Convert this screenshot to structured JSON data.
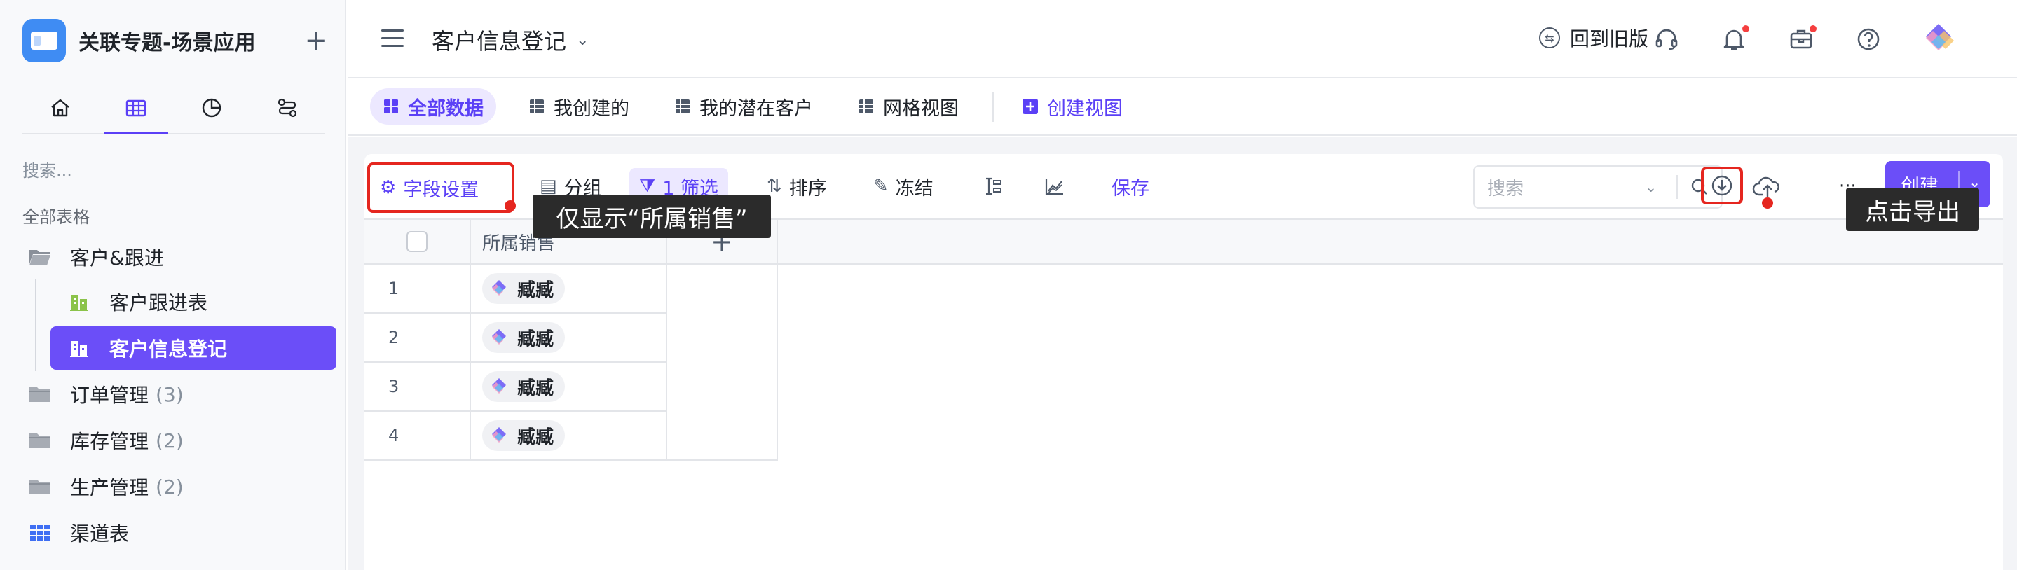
{
  "app": {
    "title": "关联专题-场景应用",
    "plus": "+"
  },
  "sidebar": {
    "search_placeholder": "搜索...",
    "section_title": "全部表格",
    "items": [
      {
        "label": "客户&跟进",
        "count": ""
      },
      {
        "label": "客户跟进表",
        "count": ""
      },
      {
        "label": "客户信息登记",
        "count": ""
      },
      {
        "label": "订单管理",
        "count": "(3)"
      },
      {
        "label": "库存管理",
        "count": "(2)"
      },
      {
        "label": "生产管理",
        "count": "(2)"
      },
      {
        "label": "渠道表",
        "count": ""
      }
    ]
  },
  "header": {
    "page_title": "客户信息登记",
    "back_old": "回到旧版"
  },
  "views": {
    "tabs": [
      "全部数据",
      "我创建的",
      "我的潜在客户",
      "网格视图"
    ],
    "create_view": "创建视图"
  },
  "toolbar": {
    "field_settings": "字段设置",
    "group": "分组",
    "filter": "1 筛选",
    "sort": "排序",
    "freeze": "冻结",
    "save": "保存",
    "search_placeholder": "搜索",
    "more": "···",
    "create": "创建"
  },
  "tooltips": {
    "field_tip": "仅显示“所属销售”",
    "export_tip": "点击导出"
  },
  "table": {
    "columns": [
      "所属销售"
    ],
    "add_column": "+",
    "rows": [
      {
        "num": "1",
        "sales": "臧臧"
      },
      {
        "num": "2",
        "sales": "臧臧"
      },
      {
        "num": "3",
        "sales": "臧臧"
      },
      {
        "num": "4",
        "sales": "臧臧"
      }
    ]
  },
  "colors": {
    "accent": "#6b4ef8",
    "highlight": "#e5261f"
  }
}
